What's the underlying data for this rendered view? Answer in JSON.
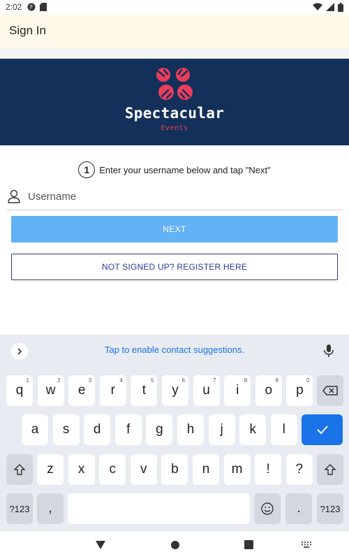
{
  "status_bar": {
    "time": "2:02"
  },
  "app_bar": {
    "title": "Sign In"
  },
  "brand": {
    "name": "Spectacular",
    "tagline": "Events"
  },
  "step": {
    "number": "1",
    "text": "Enter your username below and tap \"Next\""
  },
  "username": {
    "placeholder": "Username",
    "value": ""
  },
  "buttons": {
    "next": "NEXT",
    "register": "NOT SIGNED UP? REGISTER HERE"
  },
  "keyboard": {
    "suggestion_text": "Tap to enable contact suggestions.",
    "row1": [
      {
        "key": "q",
        "hint": "1"
      },
      {
        "key": "w",
        "hint": "2"
      },
      {
        "key": "e",
        "hint": "3"
      },
      {
        "key": "r",
        "hint": "4"
      },
      {
        "key": "t",
        "hint": "5"
      },
      {
        "key": "y",
        "hint": "6"
      },
      {
        "key": "u",
        "hint": "7"
      },
      {
        "key": "i",
        "hint": "8"
      },
      {
        "key": "o",
        "hint": "9"
      },
      {
        "key": "p",
        "hint": "0"
      }
    ],
    "row2": [
      "a",
      "s",
      "d",
      "f",
      "g",
      "h",
      "j",
      "k",
      "l"
    ],
    "row3": [
      "z",
      "x",
      "c",
      "v",
      "b",
      "n",
      "m",
      "!",
      "?"
    ],
    "symbols_key": "?123",
    "comma_key": ",",
    "emoji_key": "emoji-icon",
    "period_key": "."
  },
  "colors": {
    "banner_bg": "#13305a",
    "brand_accent": "#ea3d5c",
    "next_button": "#64b2f6",
    "register_border": "#2a3a7a",
    "keyboard_accent": "#1a73e8"
  }
}
